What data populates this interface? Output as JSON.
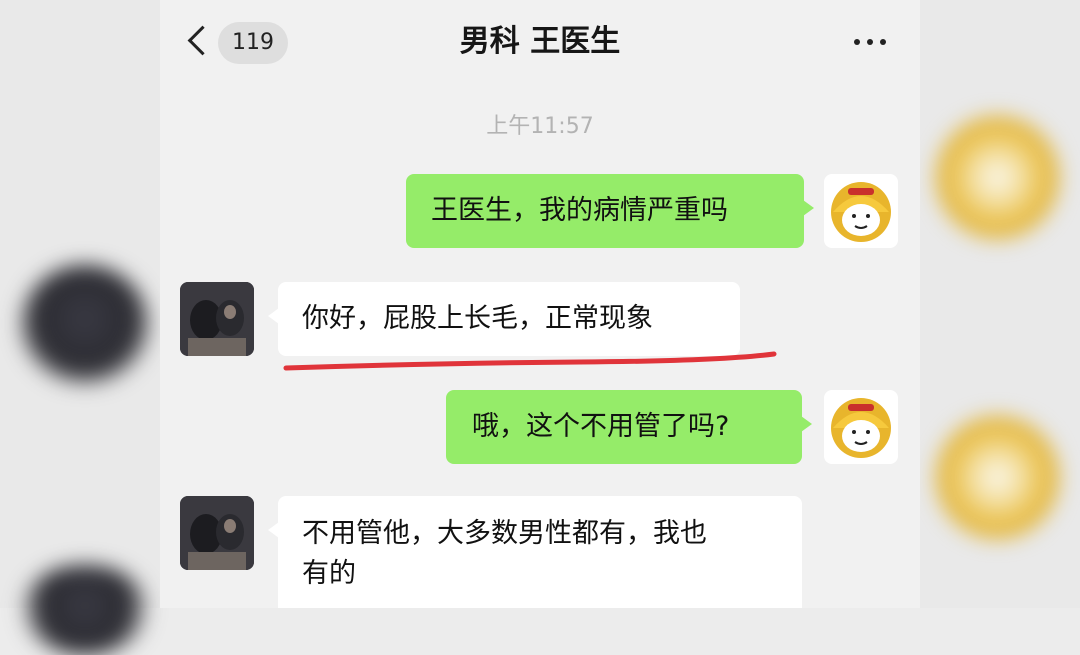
{
  "header": {
    "back_icon": "chevron-left-icon",
    "unread_count": "119",
    "title": "男科 王医生",
    "more_icon": "more-dots-icon"
  },
  "timestamp": "上午11:57",
  "messages": [
    {
      "from": "me",
      "text": "王医生，我的病情严重吗"
    },
    {
      "from": "doctor",
      "text": "你好，屁股上长毛，正常现象"
    },
    {
      "from": "me",
      "text": "哦，这个不用管了吗?"
    },
    {
      "from": "doctor",
      "text_line1": "不用管他，大多数男性都有，我也",
      "text_line2": "有的"
    }
  ],
  "colors": {
    "sent_bubble": "#95ec69",
    "received_bubble": "#ffffff",
    "chat_background": "#f1f1f1",
    "annotation_underline": "#e0343a"
  }
}
